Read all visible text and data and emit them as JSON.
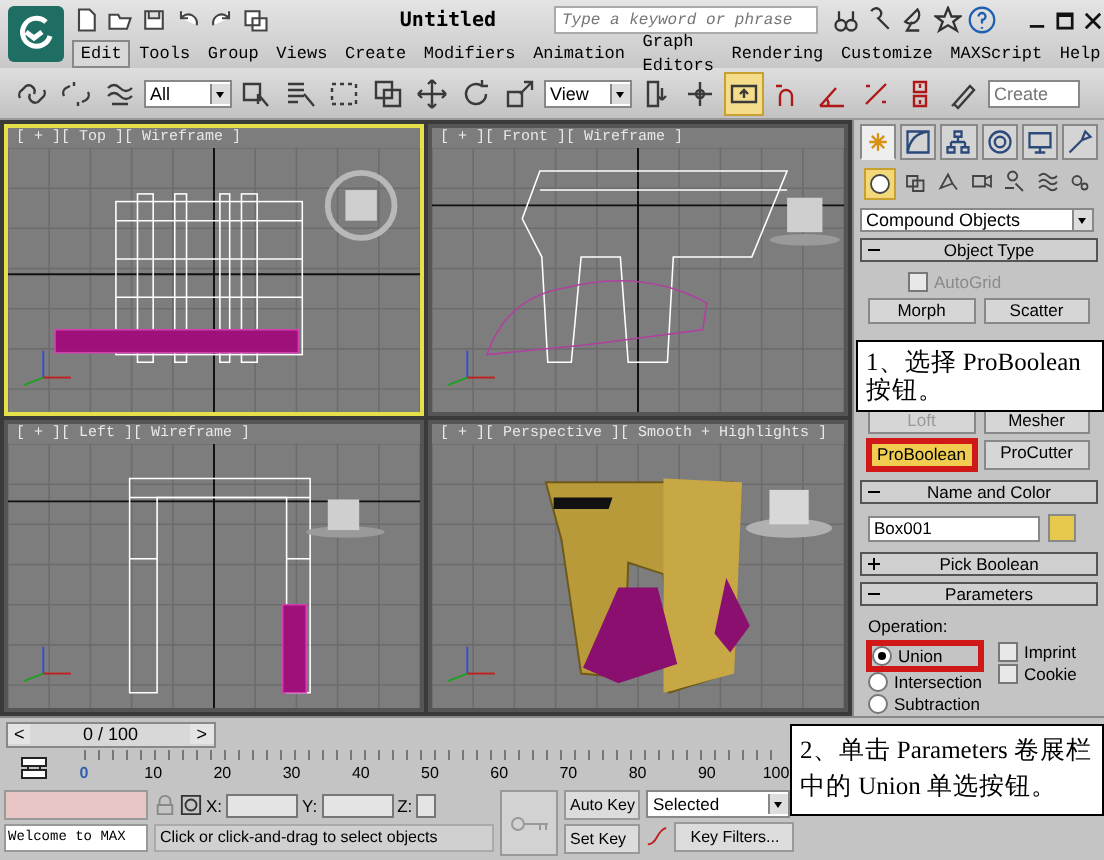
{
  "title_bar": {
    "title": "Untitled",
    "search": {
      "placeholder": "Type a keyword or phrase"
    }
  },
  "menu": [
    {
      "label": "Edit",
      "selected": true
    },
    {
      "label": "Tools",
      "selected": false
    },
    {
      "label": "Group",
      "selected": false
    },
    {
      "label": "Views",
      "selected": false
    },
    {
      "label": "Create",
      "selected": false
    },
    {
      "label": "Modifiers",
      "selected": false
    },
    {
      "label": "Animation",
      "selected": false
    },
    {
      "label": "Graph Editors",
      "selected": false
    },
    {
      "label": "Rendering",
      "selected": false
    },
    {
      "label": "Customize",
      "selected": false
    },
    {
      "label": "MAXScript",
      "selected": false
    },
    {
      "label": "Help",
      "selected": false
    }
  ],
  "toolbar": {
    "selection_filter": "All",
    "reference_coordinate": "View",
    "named_selection": {
      "placeholder": "Create"
    },
    "buttons": [
      {
        "kind": "link",
        "on": false
      },
      {
        "kind": "unlink",
        "on": false
      },
      {
        "kind": "bind",
        "on": false
      },
      {
        "kind": "filter"
      },
      {
        "kind": "select",
        "on": false
      },
      {
        "kind": "select_by_name",
        "on": false
      },
      {
        "kind": "region",
        "on": false
      },
      {
        "kind": "crossing",
        "on": false
      },
      {
        "kind": "move",
        "on": false
      },
      {
        "kind": "rotate",
        "on": false
      },
      {
        "kind": "scale",
        "on": false
      },
      {
        "kind": "coordinate"
      },
      {
        "kind": "pivot",
        "on": false
      },
      {
        "kind": "manipulate",
        "on": false
      },
      {
        "kind": "keyboard",
        "on": true
      },
      {
        "kind": "snap",
        "on": false
      },
      {
        "kind": "angle_snap",
        "on": false
      },
      {
        "kind": "percent_snap",
        "on": false
      },
      {
        "kind": "spinner_snap",
        "on": false
      },
      {
        "kind": "named_sets",
        "on": false
      },
      {
        "kind": "named_selection"
      }
    ]
  },
  "viewports": [
    {
      "kind": "top",
      "label": "[ + ][ Top ][ Wireframe ]",
      "selected": true
    },
    {
      "kind": "front",
      "label": "[ + ][ Front ][ Wireframe ]",
      "selected": false
    },
    {
      "kind": "left",
      "label": "[ + ][ Left ][ Wireframe ]",
      "selected": false
    },
    {
      "kind": "perspective",
      "label": "[ + ][ Perspective ][ Smooth + Highlights ]",
      "selected": false
    }
  ],
  "command_panel": {
    "tabs": [
      {
        "kind": "create",
        "selected": true
      },
      {
        "kind": "modify",
        "selected": false
      },
      {
        "kind": "hierarchy",
        "selected": false
      },
      {
        "kind": "motion",
        "selected": false
      },
      {
        "kind": "display",
        "selected": false
      },
      {
        "kind": "utilities",
        "selected": false
      }
    ],
    "categories": [
      {
        "kind": "geometry",
        "selected": true
      },
      {
        "kind": "shapes",
        "selected": false
      },
      {
        "kind": "lights",
        "selected": false
      },
      {
        "kind": "cameras",
        "selected": false
      },
      {
        "kind": "helpers",
        "selected": false
      },
      {
        "kind": "space_warps",
        "selected": false
      },
      {
        "kind": "systems",
        "selected": false
      }
    ],
    "subcategory": "Compound Objects",
    "object_type": {
      "title": "Object Type",
      "expanded": true,
      "autogrid": {
        "label": "AutoGrid",
        "checked": false,
        "disabled": true
      },
      "buttons": [
        {
          "label": "Morph",
          "selected": false,
          "disabled": false,
          "highlighted": false
        },
        {
          "label": "Scatter",
          "selected": false,
          "disabled": false,
          "highlighted": false
        },
        {
          "label": "Loft",
          "selected": false,
          "disabled": true,
          "highlighted": false
        },
        {
          "label": "Mesher",
          "selected": false,
          "disabled": false,
          "highlighted": false
        },
        {
          "label": "ProBoolean",
          "selected": true,
          "disabled": false,
          "highlighted": true
        },
        {
          "label": "ProCutter",
          "selected": false,
          "disabled": false,
          "highlighted": false
        }
      ]
    },
    "name_and_color": {
      "title": "Name and Color",
      "expanded": true,
      "name": "Box001",
      "color": "#e6c84c"
    },
    "pick_boolean": {
      "title": "Pick Boolean",
      "expanded": false
    },
    "parameters": {
      "title": "Parameters",
      "expanded": true,
      "group": "Operation:",
      "radios": [
        {
          "label": "Union",
          "selected": true,
          "highlighted": true
        },
        {
          "label": "Intersection",
          "selected": false,
          "highlighted": false
        },
        {
          "label": "Subtraction",
          "selected": false,
          "highlighted": false
        }
      ],
      "checkboxes": [
        {
          "label": "Imprint",
          "checked": false
        },
        {
          "label": "Cookie",
          "checked": false
        }
      ]
    }
  },
  "time_slider": {
    "previous": "<",
    "position": "0 / 100",
    "next": ">"
  },
  "track_bar": {
    "ticks": [
      "0",
      "10",
      "20",
      "30",
      "40",
      "50",
      "60",
      "70",
      "80",
      "90",
      "100"
    ]
  },
  "status_bar": {
    "listener": "Welcome to MAX",
    "x_label": "X:",
    "y_label": "Y:",
    "z_label": "Z:",
    "auto_key": "Auto Key",
    "set_key": "Set Key",
    "key_mode": "Selected",
    "key_filters": "Key Filters...",
    "prompt": "Click or click-and-drag to select objects"
  },
  "callouts": [
    {
      "text": "1、选择 ProBoolean 按钮。"
    },
    {
      "text": "2、单击 Parameters 卷展栏中的 Union 单选按钮。"
    }
  ]
}
